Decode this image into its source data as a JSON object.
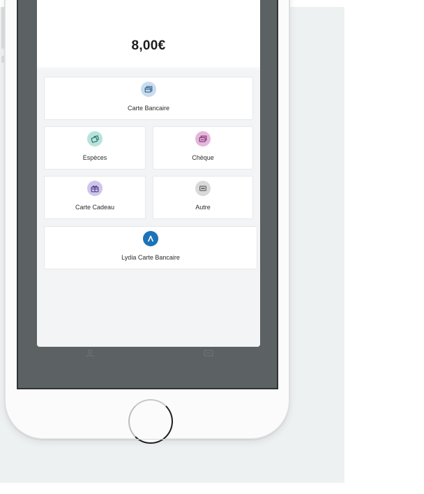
{
  "payment": {
    "amount": "8,00€",
    "methods": [
      {
        "label": "Carte Bancaire",
        "icon": "card-stack-icon",
        "color": "#4d86b3",
        "bg": "#c9dcee"
      },
      {
        "label": "Espèces",
        "icon": "cash-notes-icon",
        "color": "#2f8c7c",
        "bg": "#b8e3dc"
      },
      {
        "label": "Chèque",
        "icon": "cheque-icon",
        "color": "#9b3f86",
        "bg": "#e5b7dc"
      },
      {
        "label": "Carte Cadeau",
        "icon": "gift-icon",
        "color": "#6a58a6",
        "bg": "#cfc5ea"
      },
      {
        "label": "Autre",
        "icon": "other-dots-icon",
        "color": "#6b6b6b",
        "bg": "#d9d9d9"
      },
      {
        "label": "Lydia Carte Bancaire",
        "icon": "lydia-logo-icon",
        "color": "#ffffff",
        "bg": "#1b73b8"
      }
    ]
  },
  "colors": {
    "screen_overlay": "#5c6163",
    "page_panel": "#eef1f2"
  }
}
